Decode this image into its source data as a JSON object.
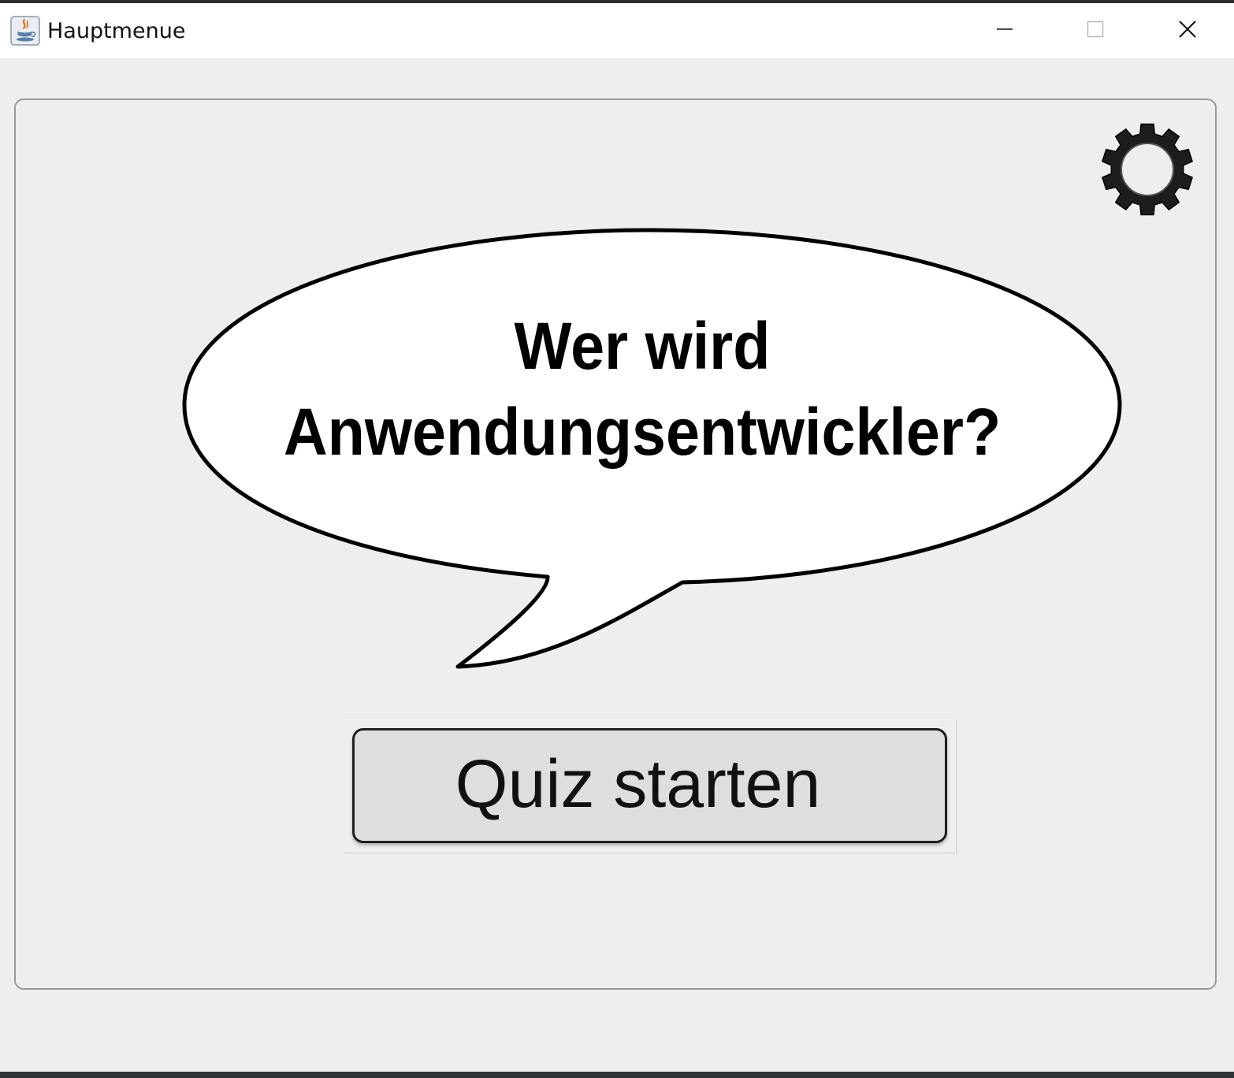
{
  "window": {
    "title": "Hauptmenue",
    "app_icon": "java-coffee-icon",
    "controls": {
      "minimize_icon": "minimize-icon",
      "maximize_icon": "maximize-icon",
      "close_icon": "close-icon"
    }
  },
  "main": {
    "settings_icon": "gear-icon",
    "speech_bubble": {
      "line1": "Wer wird",
      "line2": "Anwendungsentwickler?"
    },
    "start_button_label": "Quiz starten"
  },
  "colors": {
    "background": "#eeeeee",
    "titlebar": "#ffffff",
    "button_fill": "#dedede",
    "bubble_fill": "#ffffff",
    "outline": "#000000"
  }
}
